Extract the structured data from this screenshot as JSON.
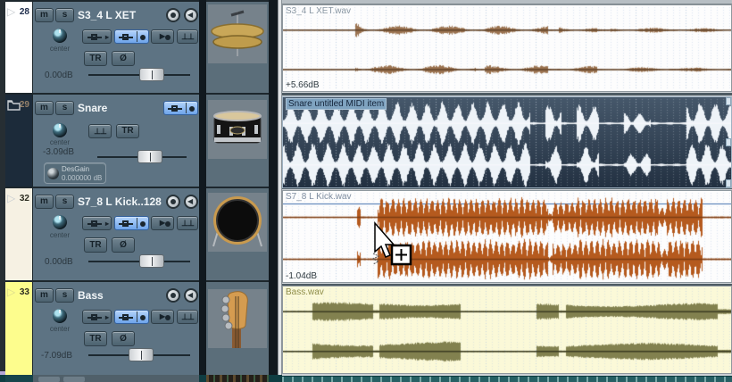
{
  "ui": {
    "mute": "m",
    "solo": "s",
    "tr": "TR",
    "phase": "Ø",
    "pan_label": "center",
    "expand_arrow": "▷",
    "play_glyph": "▶",
    "monitor_glyph": "◀",
    "sends_glyph": "⊥⊥"
  },
  "tracks": [
    {
      "number": "28",
      "name": "S3_4 L XET",
      "pan": "center",
      "volume": "0.00dB",
      "fader": 0.66,
      "color": "#ffffff",
      "number_color": "#1c2b4a",
      "arrow_color": "#c8cdd1"
    },
    {
      "number": "29",
      "name": "Snare",
      "pan": "center",
      "volume": "-3.09dB",
      "fader": 0.62,
      "color": "#1c2b3a",
      "number_color": "#93806a",
      "arrow_color": "#c8cdd1",
      "desgain_name": "DesGain",
      "desgain_value": "0.000000 dB"
    },
    {
      "number": "32",
      "name": "S7_8 L Kick..128",
      "pan": "center",
      "volume": "0.00dB",
      "fader": 0.66,
      "color": "#f6f1e3",
      "number_color": "#2c2c20",
      "arrow_color": "#c8cdd1"
    },
    {
      "number": "33",
      "name": "Bass",
      "pan": "center",
      "volume": "-7.09dB",
      "fader": 0.52,
      "color": "#fdfd8d",
      "number_color": "#2c2c20",
      "arrow_color": "#d9d98e"
    }
  ],
  "items": [
    {
      "label": "S3_4 L XET.wav",
      "gain": "+5.66dB",
      "text_color": "#8a97a3",
      "bg": "#fdfdfd",
      "grid": "#b9cfe6",
      "wave": "#9b7350",
      "line": "#5f4229",
      "style": "blocks",
      "amp": 0.2,
      "envelope": [
        [
          0,
          0.16,
          0.03
        ],
        [
          0.16,
          0.175,
          0.55
        ],
        [
          0.175,
          0.43,
          0.28
        ],
        [
          0.43,
          0.45,
          0.05
        ],
        [
          0.45,
          0.59,
          0.26
        ],
        [
          0.59,
          0.615,
          0.05
        ],
        [
          0.615,
          0.7,
          0.22
        ],
        [
          0.7,
          0.73,
          0.06
        ],
        [
          0.73,
          0.86,
          0.15
        ],
        [
          0.86,
          0.88,
          0.05
        ],
        [
          0.88,
          1.0,
          0.13
        ]
      ]
    },
    {
      "label": "Snare untitled MIDI item",
      "text_color": "#14243a",
      "bg": "#46586b",
      "bg2": "#233142",
      "grid": "rgba(236,243,249,0.55)",
      "wave": "#eef3f8",
      "line": "#f5f8fb",
      "style": "spikes",
      "freq": 0.185,
      "pw": 2.4,
      "amp": 0.26,
      "envelope": [
        [
          0,
          0.55,
          0.95
        ],
        [
          0.55,
          0.585,
          0.06
        ],
        [
          0.585,
          0.62,
          0.85
        ],
        [
          0.62,
          0.655,
          0.06
        ],
        [
          0.655,
          0.705,
          0.8
        ],
        [
          0.705,
          0.76,
          0.06
        ],
        [
          0.76,
          0.82,
          0.5
        ],
        [
          0.82,
          0.9,
          0.06
        ],
        [
          0.9,
          1.0,
          0.95
        ]
      ]
    },
    {
      "label": "S7_8 L Kick.wav",
      "gain": "-1.04dB",
      "text_color": "#7f8da0",
      "bg": "#fdfdfd",
      "grid": "#b9cfe6",
      "wave": "#b55a1e",
      "line": "#7c3c12",
      "accent": "#3f6fae",
      "style": "spikes",
      "freq": 0.5,
      "pw": 0.9,
      "amp": 0.235,
      "envelope": [
        [
          0,
          0.165,
          0.03
        ],
        [
          0.165,
          0.173,
          0.5
        ],
        [
          0.173,
          0.21,
          0.04
        ],
        [
          0.21,
          0.59,
          0.95
        ],
        [
          0.59,
          0.6,
          0.2
        ],
        [
          0.6,
          0.655,
          0.8
        ],
        [
          0.655,
          0.84,
          0.95
        ],
        [
          0.84,
          0.855,
          0.5
        ],
        [
          0.855,
          0.935,
          0.95
        ],
        [
          0.935,
          1.0,
          0.04
        ]
      ]
    },
    {
      "label": "Bass.wav",
      "text_color": "#8f8e4a",
      "bg": "#fbf9d8",
      "grid": "#c5d4e2",
      "wave": "#82814f",
      "line": "#3c3c22",
      "style": "sustain",
      "amp": 0.2,
      "envelope": [
        [
          0,
          0.065,
          0.04
        ],
        [
          0.065,
          0.2,
          0.55
        ],
        [
          0.2,
          0.215,
          0.1
        ],
        [
          0.215,
          0.395,
          0.6
        ],
        [
          0.395,
          0.565,
          0.04
        ],
        [
          0.565,
          0.615,
          0.5
        ],
        [
          0.615,
          0.63,
          0.08
        ],
        [
          0.63,
          0.97,
          0.5
        ],
        [
          0.97,
          1.0,
          0.15
        ]
      ]
    }
  ]
}
